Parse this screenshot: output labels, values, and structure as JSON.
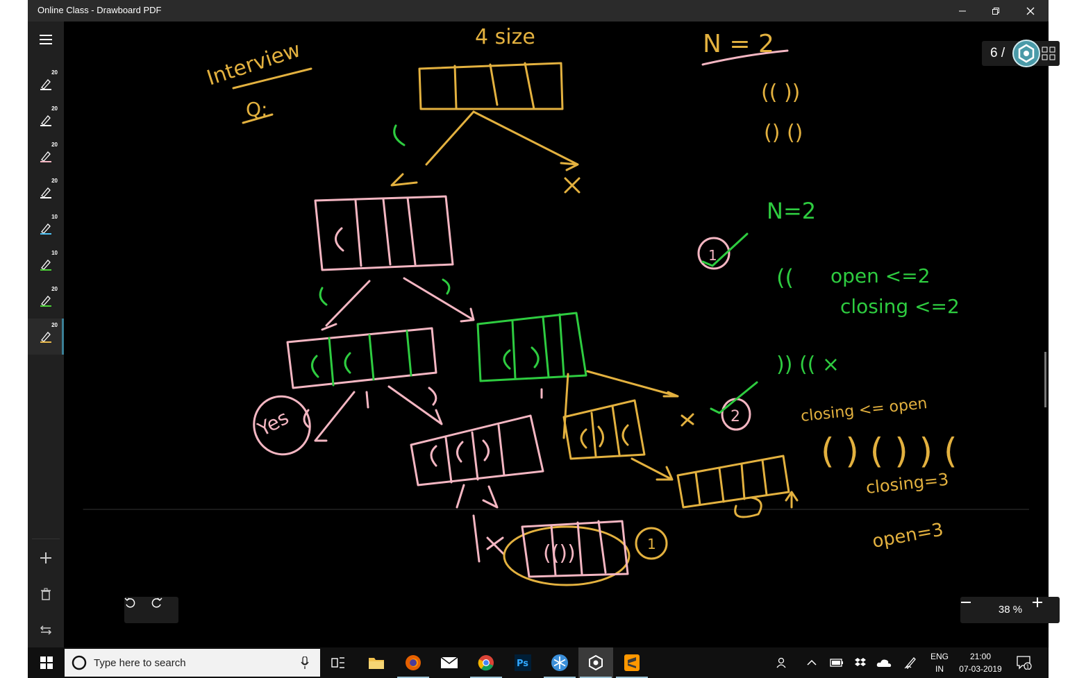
{
  "window": {
    "title": "Online Class - Drawboard PDF",
    "controls": {
      "minimize": "minimize-icon",
      "restore": "restore-icon",
      "close": "close-icon"
    }
  },
  "sidebar": {
    "menu_icon": "hamburger-icon",
    "pens": [
      {
        "size": "20",
        "color": "#ffffff"
      },
      {
        "size": "20",
        "color": "#ffffff"
      },
      {
        "size": "20",
        "color": "#f4b6c2"
      },
      {
        "size": "20",
        "color": "#ffffff"
      },
      {
        "size": "10",
        "color": "#4fc3f7"
      },
      {
        "size": "10",
        "color": "#4cd137"
      },
      {
        "size": "20",
        "color": "#4cd137"
      },
      {
        "size": "20",
        "color": "#e8b84a"
      }
    ],
    "actions": [
      "add-icon",
      "trash-icon",
      "swap-icon"
    ]
  },
  "canvas": {
    "page_indicator": "6 /",
    "zoom": "38 %",
    "ink_colors": {
      "yellow": "#e3b13f",
      "pink": "#f4b6c2",
      "green": "#2ecc40"
    },
    "handwriting": {
      "interview": "Interview",
      "q": "Q:",
      "size": "4 size",
      "n2_top": "N = 2",
      "seq1": "(( ))",
      "seq2": "() ()",
      "n2_mid": "N=2",
      "circle1": "1",
      "open_paren": "((",
      "open_rule": "open <=2",
      "closing_rule": "closing <=2",
      "invalid_seq": ")) (( ×",
      "closing_open_rule": "closing <= open",
      "closing_count": "closing=3",
      "open_count": "open=3",
      "yes": "Yes",
      "circle2": "2",
      "circle1_bottom": "1",
      "box_l1": "(",
      "box_l2a": "((",
      "box_l2b": "()",
      "box_l3a": "((()",
      "box_l3b": "()(",
      "box_l4": "()(()",
      "box_final": "(())",
      "x_mark": "×"
    }
  },
  "taskbar": {
    "search_placeholder": "Type here to search",
    "language": "ENG",
    "region": "IN",
    "time": "21:00",
    "date": "07-03-2019",
    "notification_count": "1"
  }
}
